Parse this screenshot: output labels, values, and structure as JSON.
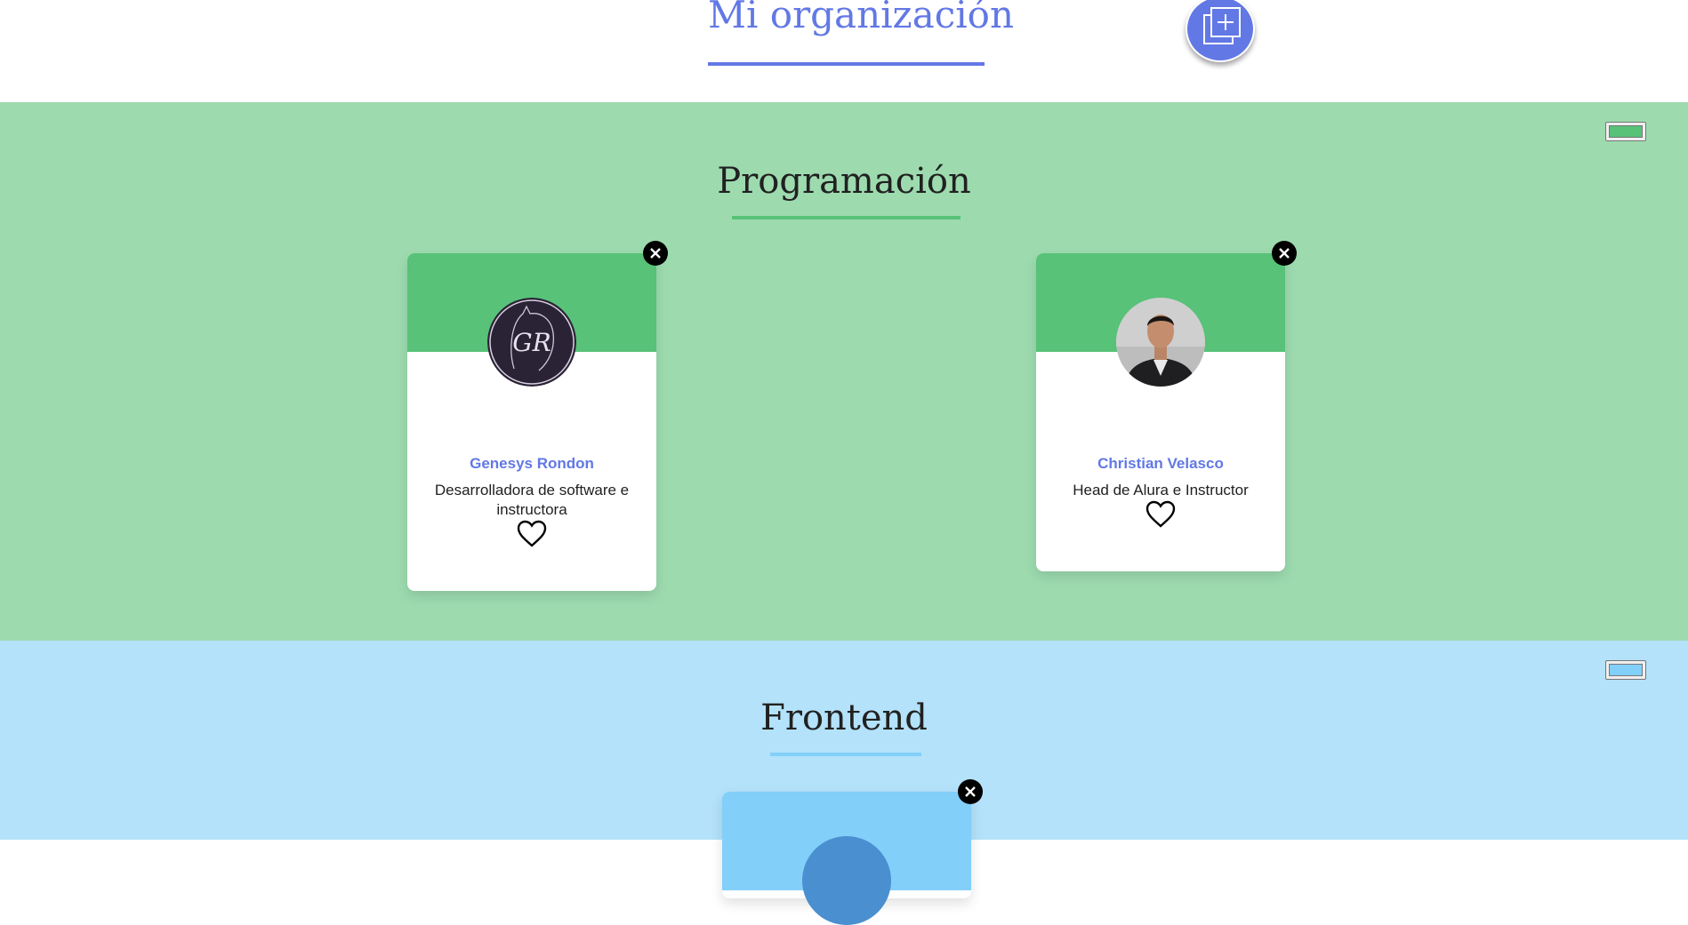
{
  "header": {
    "title": "Mi organización",
    "add_button_icon": "add-copy-icon",
    "accent_color": "#6278E5"
  },
  "teams": [
    {
      "title": "Programación",
      "primary_color": "#57C278",
      "secondary_color": "#9DDBAF",
      "members": [
        {
          "name": "Genesys Rondon",
          "role": "Desarrolladora de software e instructora",
          "avatar_icon": "gr-logo-avatar",
          "liked": false
        },
        {
          "name": "Christian Velasco",
          "role": "Head de Alura e Instructor",
          "avatar_icon": "person-photo-avatar",
          "liked": false
        }
      ]
    },
    {
      "title": "Frontend",
      "primary_color": "#82CFFA",
      "secondary_color": "#B3E2FA",
      "members": []
    }
  ]
}
